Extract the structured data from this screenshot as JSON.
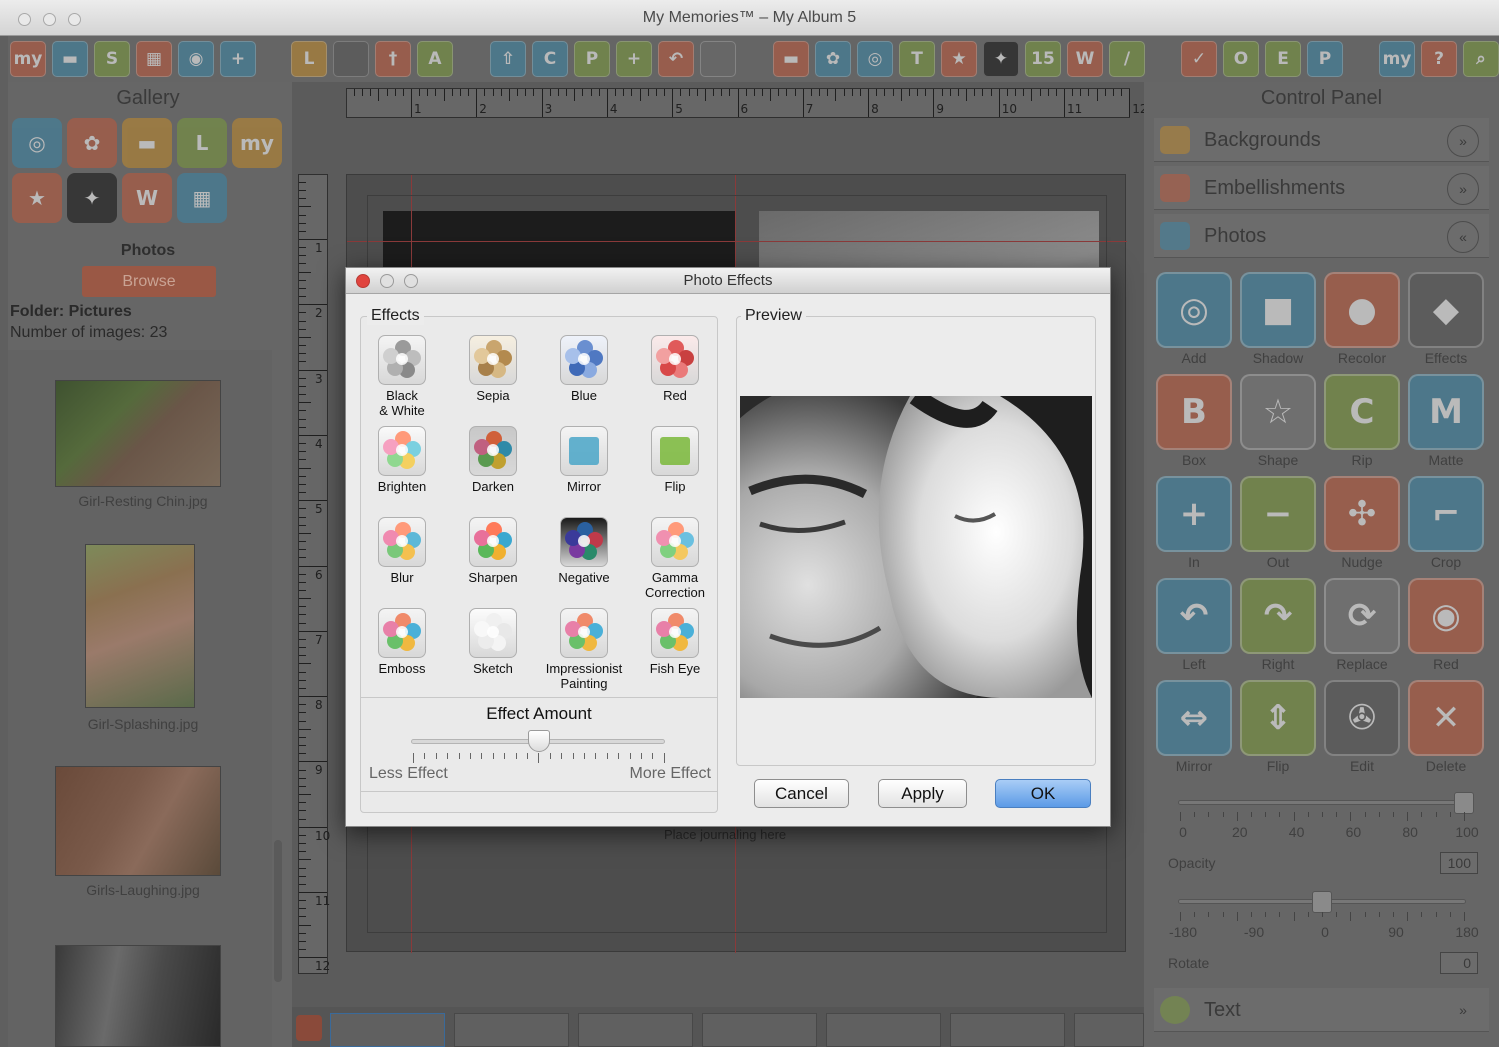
{
  "window": {
    "title": "My Memories™ – My Album 5"
  },
  "toolbar": {
    "items": [
      {
        "icon": "my-logo-icon",
        "label": "my",
        "color": "#c0583a"
      },
      {
        "icon": "folder-icon",
        "label": "▬",
        "color": "#3a86a8"
      },
      {
        "icon": "s-box-icon",
        "label": "S",
        "color": "#7a9a3a"
      },
      {
        "icon": "layout-icon",
        "label": "▦",
        "color": "#c0583a"
      },
      {
        "icon": "shield-icon",
        "label": "◉",
        "color": "#3a86a8"
      },
      {
        "icon": "add-page-icon",
        "label": "+",
        "color": "#3a86a8"
      },
      {
        "icon": "layout-l-icon",
        "label": "L",
        "color": "#c28a2a"
      },
      {
        "icon": "grid-icon",
        "label": "",
        "color": "#555555"
      },
      {
        "icon": "guide-icon",
        "label": "†",
        "color": "#c0583a"
      },
      {
        "icon": "text-a-icon",
        "label": "A",
        "color": "#7a9a3a"
      },
      {
        "icon": "share-icon",
        "label": "⇧",
        "color": "#3a86a8"
      },
      {
        "icon": "copy-icon",
        "label": "C",
        "color": "#3a86a8"
      },
      {
        "icon": "paste-icon",
        "label": "P",
        "color": "#7a9a3a"
      },
      {
        "icon": "add-icon",
        "label": "+",
        "color": "#7a9a3a"
      },
      {
        "icon": "undo-icon",
        "label": "↶",
        "color": "#c0583a"
      },
      {
        "icon": "redo-icon",
        "label": "",
        "color": "#6a6a6a"
      },
      {
        "icon": "backgrounds-icon",
        "label": "▬",
        "color": "#c0583a"
      },
      {
        "icon": "embellishments-icon",
        "label": "✿",
        "color": "#3a86a8"
      },
      {
        "icon": "camera-icon",
        "label": "◎",
        "color": "#3a86a8"
      },
      {
        "icon": "text-icon",
        "label": "T",
        "color": "#7a9a3a"
      },
      {
        "icon": "star-icon",
        "label": "★",
        "color": "#c0583a"
      },
      {
        "icon": "butterfly-icon",
        "label": "✦",
        "color": "#111111"
      },
      {
        "icon": "calendar-icon",
        "label": "15",
        "color": "#7a9a3a"
      },
      {
        "icon": "wordart-icon",
        "label": "W",
        "color": "#c0583a"
      },
      {
        "icon": "pen-icon",
        "label": "/",
        "color": "#7a9a3a"
      },
      {
        "icon": "spellcheck-icon",
        "label": "✓",
        "color": "#c0583a"
      },
      {
        "icon": "o-box-icon",
        "label": "O",
        "color": "#7a9a3a"
      },
      {
        "icon": "e-box-icon",
        "label": "E",
        "color": "#7a9a3a"
      },
      {
        "icon": "p-box-icon",
        "label": "P",
        "color": "#3a86a8"
      },
      {
        "icon": "mycom-icon",
        "label": "my",
        "color": "#3a86a8"
      },
      {
        "icon": "help-icon",
        "label": "?",
        "color": "#c0583a"
      },
      {
        "icon": "zoom-icon",
        "label": "⌕",
        "color": "#7a9a3a"
      }
    ]
  },
  "gallery": {
    "title": "Gallery",
    "categories": [
      {
        "icon": "camera-icon",
        "label": "◎",
        "color": "#3a86a8"
      },
      {
        "icon": "flower-icon",
        "label": "✿",
        "color": "#c0583a"
      },
      {
        "icon": "backgrounds-icon",
        "label": "▬",
        "color": "#c28a2a"
      },
      {
        "icon": "layout-l-icon",
        "label": "L",
        "color": "#7a9a3a"
      },
      {
        "icon": "mycom-icon",
        "label": "my",
        "color": "#c28a2a"
      },
      {
        "icon": "star-icon",
        "label": "★",
        "color": "#c0583a"
      },
      {
        "icon": "butterfly-icon",
        "label": "✦",
        "color": "#111111"
      },
      {
        "icon": "wordart-icon",
        "label": "W",
        "color": "#c0583a"
      },
      {
        "icon": "layout-icon",
        "label": "▦",
        "color": "#3a86a8"
      }
    ],
    "section_title": "Photos",
    "browse_label": "Browse",
    "folder_label": "Folder: Pictures",
    "count_label": "Number of images: 23",
    "thumbnails": [
      {
        "caption": "Girl-Resting Chin.jpg"
      },
      {
        "caption": "Girl-Splashing.jpg"
      },
      {
        "caption": "Girls-Laughing.jpg"
      },
      {
        "caption": ""
      }
    ]
  },
  "canvas": {
    "ruler_h": [
      "1",
      "2",
      "3",
      "4",
      "5",
      "6",
      "7",
      "8",
      "9",
      "10",
      "11",
      "12"
    ],
    "ruler_v": [
      "1",
      "2",
      "3",
      "4",
      "5",
      "6",
      "7",
      "8",
      "9",
      "10",
      "11",
      "12"
    ],
    "journaling": "Place journaling here"
  },
  "control_panel": {
    "title": "Control Panel",
    "sections": [
      {
        "label": "Backgrounds",
        "icon": "backgrounds-icon",
        "chevron": "»"
      },
      {
        "label": "Embellishments",
        "icon": "embellishments-icon",
        "chevron": "»"
      },
      {
        "label": "Photos",
        "icon": "camera-icon",
        "chevron": "«"
      }
    ],
    "photo_buttons": [
      {
        "label": "Add",
        "icon": "camera-icon",
        "glyph": "◎",
        "color": "#3a86a8"
      },
      {
        "label": "Shadow",
        "icon": "shadow-icon",
        "glyph": "■",
        "color": "#3a86a8"
      },
      {
        "label": "Recolor",
        "icon": "recolor-icon",
        "glyph": "●",
        "color": "#c0583a"
      },
      {
        "label": "Effects",
        "icon": "effects-icon",
        "glyph": "◆",
        "color": "#555555"
      },
      {
        "label": "Box",
        "icon": "box-icon",
        "glyph": "B",
        "color": "#c0583a"
      },
      {
        "label": "Shape",
        "icon": "shape-icon",
        "glyph": "☆",
        "color": "#777777"
      },
      {
        "label": "Rip",
        "icon": "rip-icon",
        "glyph": "C",
        "color": "#7a9a3a"
      },
      {
        "label": "Matte",
        "icon": "matte-icon",
        "glyph": "M",
        "color": "#3a86a8"
      },
      {
        "label": "In",
        "icon": "zoom-in-icon",
        "glyph": "+",
        "color": "#3a86a8"
      },
      {
        "label": "Out",
        "icon": "zoom-out-icon",
        "glyph": "−",
        "color": "#7a9a3a"
      },
      {
        "label": "Nudge",
        "icon": "nudge-icon",
        "glyph": "✣",
        "color": "#c0583a"
      },
      {
        "label": "Crop",
        "icon": "crop-icon",
        "glyph": "⌐",
        "color": "#3a86a8"
      },
      {
        "label": "Left",
        "icon": "rotate-left-icon",
        "glyph": "↶",
        "color": "#3a86a8"
      },
      {
        "label": "Right",
        "icon": "rotate-right-icon",
        "glyph": "↷",
        "color": "#7a9a3a"
      },
      {
        "label": "Replace",
        "icon": "replace-icon",
        "glyph": "⟳",
        "color": "#777777"
      },
      {
        "label": "Red",
        "icon": "red-eye-icon",
        "glyph": "◉",
        "color": "#c0583a"
      },
      {
        "label": "Mirror",
        "icon": "mirror-icon",
        "glyph": "⇔",
        "color": "#3a86a8"
      },
      {
        "label": "Flip",
        "icon": "flip-icon",
        "glyph": "⇕",
        "color": "#7a9a3a"
      },
      {
        "label": "Edit",
        "icon": "edit-icon",
        "glyph": "✇",
        "color": "#555555"
      },
      {
        "label": "Delete",
        "icon": "delete-icon",
        "glyph": "✕",
        "color": "#c0583a"
      }
    ],
    "opacity": {
      "label": "Opacity",
      "ticks": [
        "0",
        "20",
        "40",
        "60",
        "80",
        "100"
      ],
      "value": "100",
      "min": 0,
      "max": 100,
      "level": 100
    },
    "rotate": {
      "label": "Rotate",
      "ticks": [
        "-180",
        "-90",
        "0",
        "90",
        "180"
      ],
      "value": "0",
      "min": -180,
      "max": 180,
      "level": 0
    },
    "text_section": {
      "label": "Text",
      "chevron": "»"
    }
  },
  "dialog": {
    "title": "Photo Effects",
    "effects_title": "Effects",
    "preview_title": "Preview",
    "effects": [
      {
        "label": "Black\n& White",
        "icon": "black-white-icon",
        "colors": [
          "#9a9a9a",
          "#bdbdbd",
          "#8a8a8a",
          "#b0b0b0",
          "#cfcfcf"
        ],
        "bg": "#f4f4f4"
      },
      {
        "label": "Sepia",
        "icon": "sepia-icon",
        "colors": [
          "#c9a56e",
          "#b38a4e",
          "#d6b884",
          "#a8804a",
          "#e2c89a"
        ],
        "bg": "#f6efe0"
      },
      {
        "label": "Blue",
        "icon": "blue-icon",
        "colors": [
          "#6a8fd0",
          "#4f78c2",
          "#8aaae0",
          "#3f6ab8",
          "#a7c0ea"
        ],
        "bg": "#eef2fa"
      },
      {
        "label": "Red",
        "icon": "red-icon",
        "colors": [
          "#e05a5a",
          "#c94040",
          "#ea7a7a",
          "#d84848",
          "#f2a0a0"
        ],
        "bg": "#fbeaea"
      },
      {
        "label": "Brighten",
        "icon": "brighten-icon",
        "colors": [
          "#ff9a7a",
          "#7ad0e0",
          "#f4d060",
          "#90d890",
          "#f6a0c0"
        ],
        "bg": "#fafafa"
      },
      {
        "label": "Darken",
        "icon": "darken-icon",
        "colors": [
          "#d0603a",
          "#2f8aa8",
          "#c0a030",
          "#5a9a50",
          "#c06080"
        ],
        "bg": "#c8c8c8"
      },
      {
        "label": "Mirror",
        "icon": "mirror-effect-icon",
        "colors": [],
        "bg": "#f4f4f4"
      },
      {
        "label": "Flip",
        "icon": "flip-effect-icon",
        "colors": [],
        "bg": "#f4f4f4"
      },
      {
        "label": "Blur",
        "icon": "blur-icon",
        "colors": [
          "#ff9a7a",
          "#5cb8d8",
          "#f4c050",
          "#7ac87a",
          "#f08ab0"
        ],
        "bg": "#f4f4f4"
      },
      {
        "label": "Sharpen",
        "icon": "sharpen-icon",
        "colors": [
          "#ff7a5a",
          "#3aa8d0",
          "#f0b030",
          "#5ab85a",
          "#e8709a"
        ],
        "bg": "#f4f4f4"
      },
      {
        "label": "Negative",
        "icon": "negative-icon",
        "colors": [
          "#2a60a0",
          "#c03a4a",
          "#2a8a6a",
          "#7a3aa0",
          "#3a3a9a"
        ],
        "bg": "#1a1a1a"
      },
      {
        "label": "Gamma\nCorrection",
        "icon": "gamma-icon",
        "colors": [
          "#ff9a7a",
          "#6ac0e0",
          "#f4c860",
          "#80d080",
          "#f090b0"
        ],
        "bg": "#f4f4f4"
      },
      {
        "label": "Emboss",
        "icon": "emboss-icon",
        "colors": [
          "#f08a6a",
          "#4ab0d8",
          "#f0b840",
          "#6ac06a",
          "#e880a8"
        ],
        "bg": "#f4f4f4"
      },
      {
        "label": "Sketch",
        "icon": "sketch-icon",
        "colors": [
          "#f0f0f0",
          "#e8e8e8",
          "#f4f4f4",
          "#ececec",
          "#f8f8f8"
        ],
        "bg": "#fcfcfc"
      },
      {
        "label": "Impressionist\nPainting",
        "icon": "impressionist-icon",
        "colors": [
          "#f08a6a",
          "#4ab0d8",
          "#f0b840",
          "#6ac06a",
          "#e880a8"
        ],
        "bg": "#f4f4f4"
      },
      {
        "label": "Fish Eye",
        "icon": "fish-eye-icon",
        "colors": [
          "#f08a6a",
          "#4ab0d8",
          "#f0b840",
          "#6ac06a",
          "#e880a8"
        ],
        "bg": "#f4f4f4"
      }
    ],
    "amount": {
      "title": "Effect Amount",
      "less": "Less Effect",
      "more": "More Effect",
      "level": 0.5
    },
    "buttons": {
      "cancel": "Cancel",
      "apply": "Apply",
      "ok": "OK"
    }
  }
}
